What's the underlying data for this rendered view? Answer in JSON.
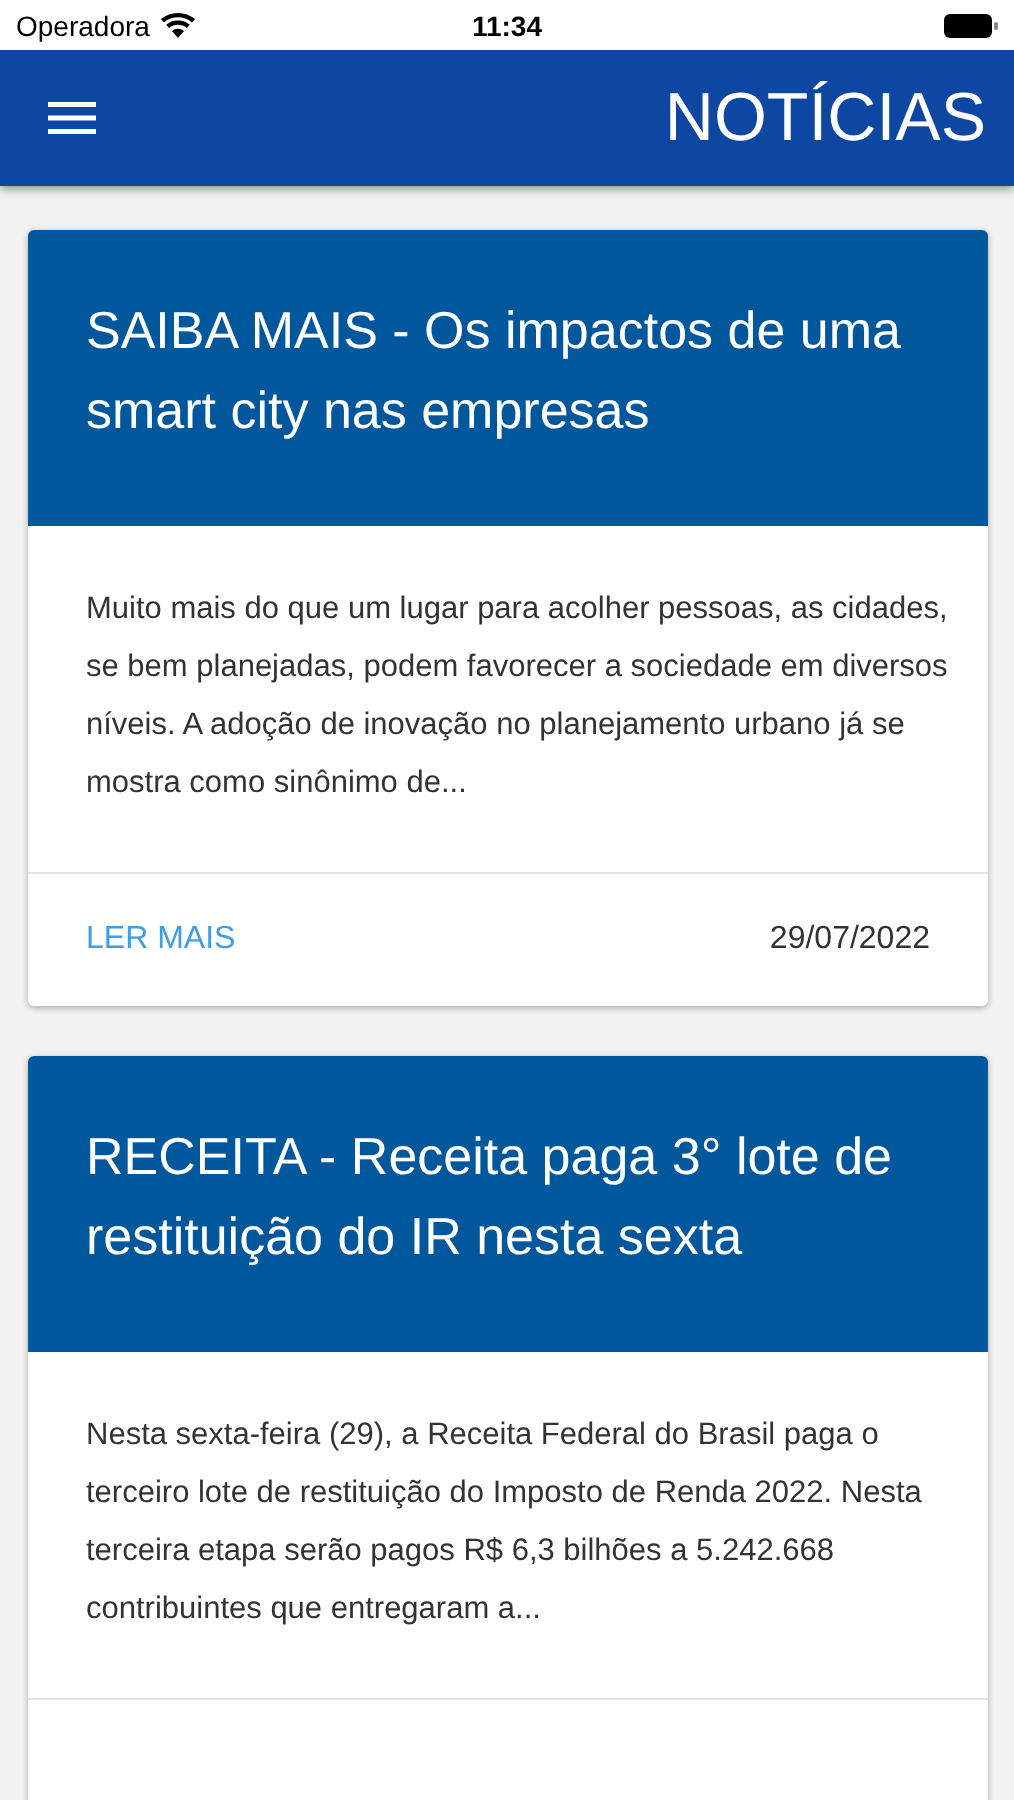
{
  "status_bar": {
    "carrier": "Operadora",
    "time": "11:34"
  },
  "app_bar": {
    "title": "NOTÍCIAS"
  },
  "news": [
    {
      "title": "SAIBA MAIS - Os impactos de uma smart city nas empresas",
      "summary": "Muito mais do que um lugar para acolher pessoas, as cidades, se bem planejadas, podem favorecer a sociedade em diversos níveis. A adoção de inovação no planejamento urbano já se mostra como sinônimo de...",
      "link": "LER MAIS",
      "date": "29/07/2022"
    },
    {
      "title": "RECEITA - Receita paga 3° lote de restituição do IR nesta sexta",
      "summary": "Nesta sexta-feira (29), a Receita Federal do Brasil paga o terceiro lote de restituição do Imposto de Renda 2022. Nesta terceira etapa serão pagos R$ 6,3 bilhões a 5.242.668 contribuintes que entregaram a..."
    }
  ]
}
